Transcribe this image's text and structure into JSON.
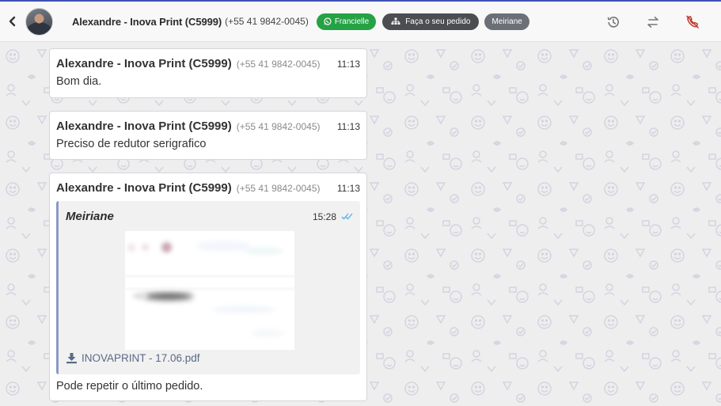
{
  "header": {
    "contact_name": "Alexandre - Inova Print (C5999)",
    "contact_phone": "(+55 41 9842-0045)",
    "tags": {
      "channel": "Francielle",
      "order": "Faça o seu pedido",
      "agent": "Meiriane"
    },
    "icons": [
      "back-icon",
      "history-icon",
      "transfer-icon",
      "end-call-icon"
    ]
  },
  "messages": [
    {
      "sender": "Alexandre - Inova Print (C5999)",
      "phone": "(+55 41 9842-0045)",
      "time": "11:13",
      "text": "Bom dia."
    },
    {
      "sender": "Alexandre - Inova Print (C5999)",
      "phone": "(+55 41 9842-0045)",
      "time": "11:13",
      "text": "Preciso de redutor serigrafico"
    },
    {
      "sender": "Alexandre - Inova Print (C5999)",
      "phone": "(+55 41 9842-0045)",
      "time": "11:13",
      "quote": {
        "author": "Meiriane",
        "time": "15:28",
        "attachment_name": "INOVAPRINT - 17.06.pdf"
      },
      "text": "Pode repetir o último pedido."
    }
  ],
  "colors": {
    "accent": "#3f51b5",
    "whatsapp_green": "#25a244",
    "end_call_red": "#c0392b",
    "read_check": "#4fb3e8"
  }
}
